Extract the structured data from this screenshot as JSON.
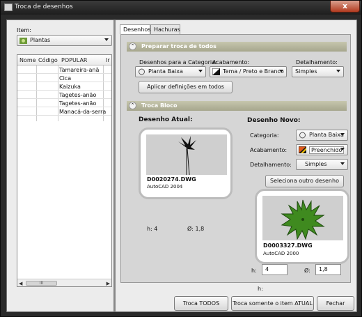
{
  "window": {
    "title": "Troca de desenhos",
    "close_glyph": "x"
  },
  "left": {
    "item_label": "Item:",
    "item_combo": "Plantas",
    "grid_headers": [
      "Nome",
      "Código",
      "POPULAR",
      "Ir"
    ],
    "rows": [
      "Tamareira-anã",
      "Cica",
      "Kaizuka",
      "Tagetes-anão",
      "Tagetes-anão",
      "Manacá-da-serra"
    ],
    "scroll_thumb": "III"
  },
  "tabs": [
    "Desenhos",
    "Hachuras"
  ],
  "prep": {
    "title": "Preparar troca de todos",
    "cat_label": "Desenhos para a Categoria:",
    "cat_value": "Planta Baixa",
    "acab_label": "Acabamento:",
    "acab_value": "Tema / Preto e Branco",
    "det_label": "Detalhamento:",
    "det_value": "Simples",
    "apply_button": "Aplicar definições em todos"
  },
  "bloco": {
    "title": "Troca Bloco",
    "atual_label": "Desenho Atual:",
    "atual_file": "D0020274.DWG",
    "atual_version": "AutoCAD 2004",
    "atual_h": "h: 4",
    "atual_o": "Ø: 1,8",
    "novo_label": "Desenho Novo:",
    "categoria_label": "Categoria:",
    "categoria_value": "Planta Baixa",
    "acabamento_label": "Acabamento:",
    "acabamento_value": "Preenchido",
    "detalhamento_label": "Detalhamento:",
    "detalhamento_value": "Simples",
    "select_other": "Seleciona outro desenho",
    "novo_file": "D0003327.DWG",
    "novo_version": "AutoCAD 2000",
    "h_label": "h:",
    "h_value": "4",
    "o_label": "Ø:",
    "o_value": "1,8"
  },
  "footer": {
    "troca_todos": "Troca TODOS",
    "troca_atual": "Troca somente o item ATUAL",
    "fechar": "Fechar"
  }
}
